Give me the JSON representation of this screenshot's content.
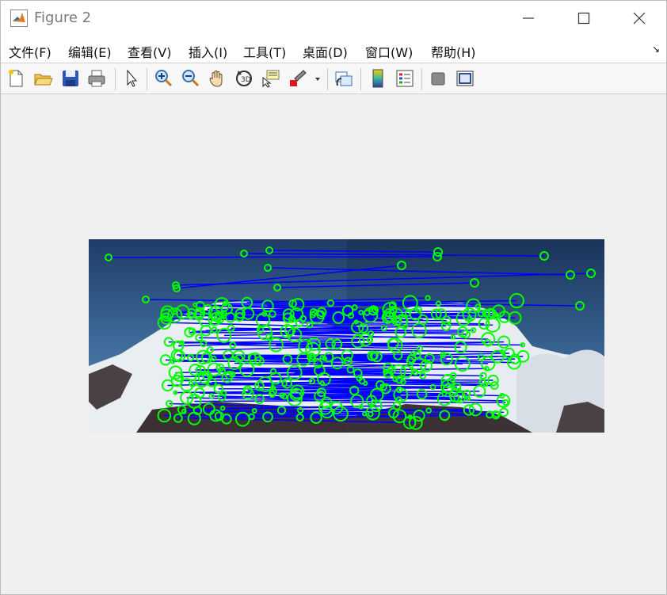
{
  "window": {
    "title": "Figure 2"
  },
  "menu": {
    "items": [
      "文件(F)",
      "编辑(E)",
      "查看(V)",
      "插入(I)",
      "工具(T)",
      "桌面(D)",
      "窗口(W)",
      "帮助(H)"
    ]
  },
  "toolbar": {
    "buttons": [
      "new-figure-icon",
      "open-file-icon",
      "save-icon",
      "print-icon",
      "select-arrow-icon",
      "zoom-in-icon",
      "zoom-out-icon",
      "pan-hand-icon",
      "rotate-3d-icon",
      "data-cursor-icon",
      "brush-icon",
      "link-plot-icon",
      "colorbar-icon",
      "legend-icon",
      "hide-plot-tools-icon",
      "show-plot-tools-icon"
    ]
  },
  "colors": {
    "match_line": "#0000ff",
    "feature_marker": "#00ff00",
    "sky_top": "#1f3c67",
    "sky_bottom": "#4f7eab"
  }
}
